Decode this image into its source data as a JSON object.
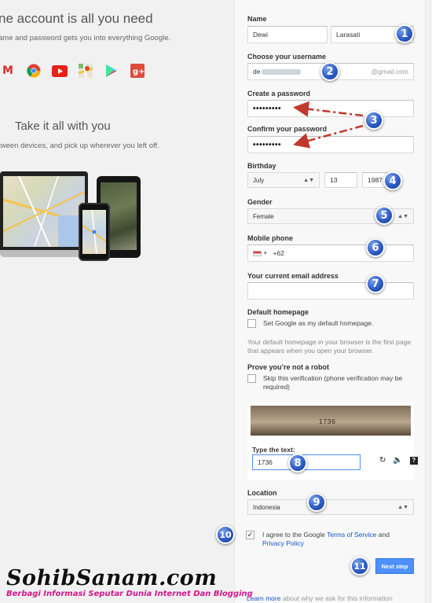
{
  "left": {
    "headline": "ne account is all you need",
    "subline": "ame and password gets you into everything Google.",
    "apps": [
      {
        "icon": "gmail-icon",
        "glyph": "M",
        "color": "#d93025"
      },
      {
        "icon": "chrome-icon",
        "glyph": "●",
        "color": "#f4b400"
      },
      {
        "icon": "youtube-icon",
        "glyph": "▶",
        "color": "#e62117"
      },
      {
        "icon": "maps-icon",
        "glyph": "▣",
        "color": "#4aa84a"
      },
      {
        "icon": "play-icon",
        "glyph": "▶",
        "color": "#34a853"
      },
      {
        "icon": "google-plus-icon",
        "glyph": "g+",
        "color": "#dd4b39"
      }
    ],
    "take_title": "Take it all with you",
    "between": "tween devices, and pick up wherever you left off."
  },
  "form": {
    "name_label": "Name",
    "first_name": "Dewi",
    "last_name": "Larasati",
    "username_label": "Choose your username",
    "username_prefix": "de",
    "username_suffix": "@gmail.com",
    "password_label": "Create a password",
    "password_value": "•••••••••",
    "confirm_label": "Confirm your password",
    "confirm_value": "•••••••••",
    "birthday_label": "Birthday",
    "birth_month": "July",
    "birth_day": "13",
    "birth_year": "1987",
    "gender_label": "Gender",
    "gender_value": "Female",
    "mobile_label": "Mobile phone",
    "mobile_code": "+62",
    "email_label": "Your current email address",
    "homepage_label": "Default homepage",
    "homepage_checkbox": "Set Google as my default homepage.",
    "homepage_note": "Your default homepage in your browser is the first page that appears when you open your browser.",
    "robot_label": "Prove you’re not a robot",
    "robot_checkbox": "Skip this verification (phone verification may be required)",
    "captcha_code": "1736",
    "type_text_label": "Type the text:",
    "captcha_answer": "1736",
    "location_label": "Location",
    "location_value": "Indonesia",
    "agree_prefix": "I agree to the Google",
    "terms_link": "Terms of Service",
    "agree_and": "and",
    "privacy_link": "Privacy Policy",
    "next_button": "Next step",
    "learn_more_link": "Learn more",
    "learn_more_rest": "about why we ask for this information"
  },
  "badges": [
    "1",
    "2",
    "3",
    "4",
    "5",
    "6",
    "7",
    "8",
    "9",
    "10",
    "11"
  ],
  "watermark": {
    "title": "SohibSanam.com",
    "subtitle": "Berbagi Informasi Seputar Dunia Internet Dan Blogging"
  },
  "colors": {
    "accent": "#4d90fe",
    "arrow": "#c0392b",
    "badge": "#2c5cc5"
  }
}
